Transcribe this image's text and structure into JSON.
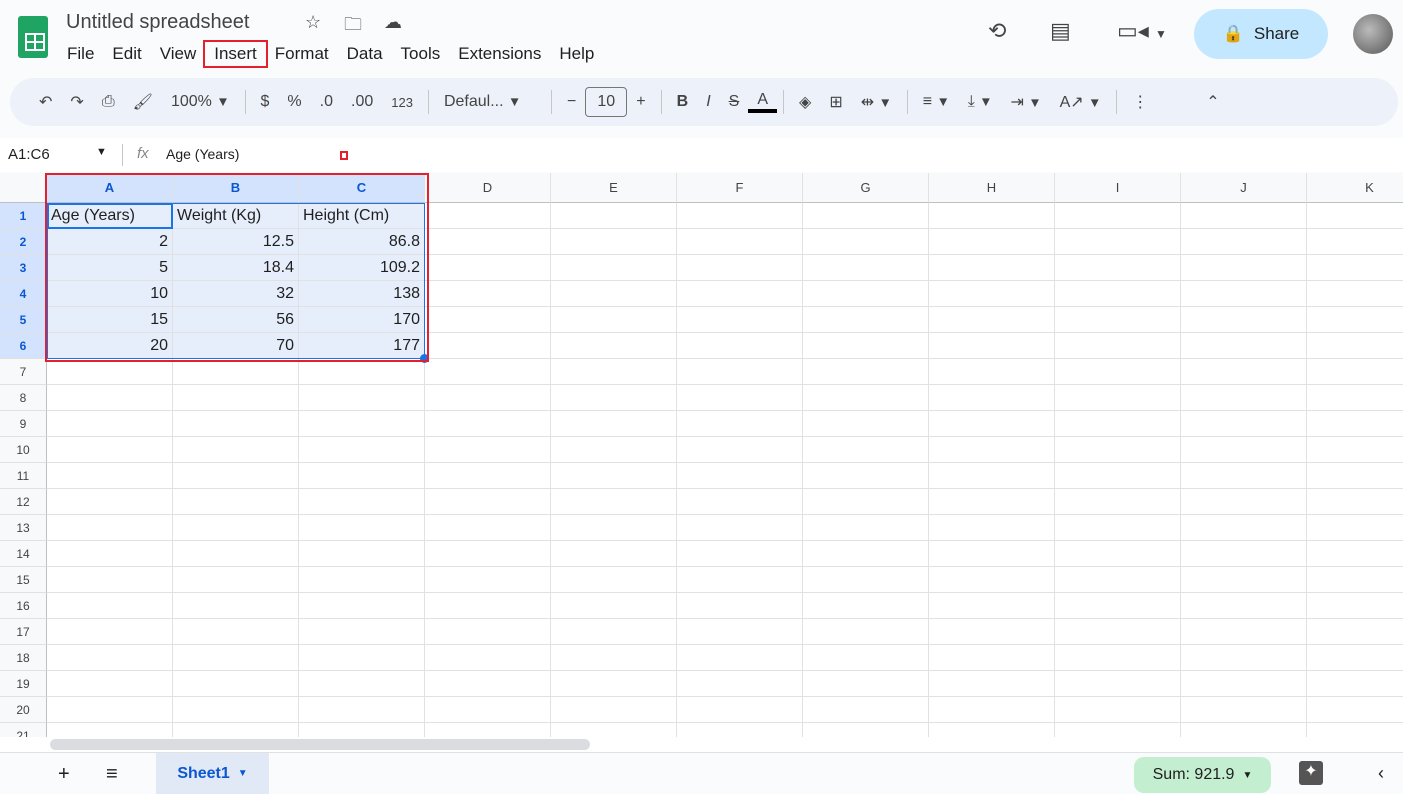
{
  "app": {
    "title": "Untitled spreadsheet"
  },
  "menu": [
    "File",
    "Edit",
    "View",
    "Insert",
    "Format",
    "Data",
    "Tools",
    "Extensions",
    "Help"
  ],
  "share_label": "Share",
  "toolbar": {
    "zoom": "100%",
    "currency": "$",
    "percent": "%",
    "dec_dec": ".0",
    "inc_dec": ".00",
    "format123": "123",
    "font": "Defaul...",
    "font_size": "10"
  },
  "formula": {
    "name_box": "A1:C6",
    "fx": "fx",
    "content": "Age (Years)"
  },
  "columns": [
    "A",
    "B",
    "C",
    "D",
    "E",
    "F",
    "G",
    "H",
    "I",
    "J",
    "K"
  ],
  "rows": [
    "1",
    "2",
    "3",
    "4",
    "5",
    "6",
    "7",
    "8",
    "9",
    "10",
    "11",
    "12",
    "13",
    "14",
    "15",
    "16",
    "17",
    "18",
    "19",
    "20",
    "21"
  ],
  "cells": [
    [
      "Age (Years)",
      "Weight (Kg)",
      "Height (Cm)"
    ],
    [
      "2",
      "12.5",
      "86.8"
    ],
    [
      "5",
      "18.4",
      "109.2"
    ],
    [
      "10",
      "32",
      "138"
    ],
    [
      "15",
      "56",
      "170"
    ],
    [
      "20",
      "70",
      "177"
    ]
  ],
  "sheet_tab": "Sheet1",
  "sum": "Sum: 921.9"
}
